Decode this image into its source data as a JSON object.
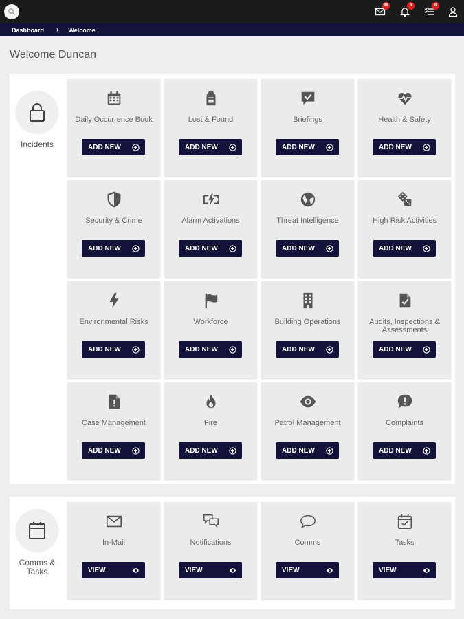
{
  "breadcrumb": {
    "items": [
      "Dashboard",
      "Welcome"
    ]
  },
  "header": {
    "badges": {
      "mail": "99",
      "notifications": "8",
      "tasks": "8"
    }
  },
  "welcome": "Welcome Duncan",
  "incidents": {
    "label": "Incidents",
    "button_label": "ADD NEW",
    "tiles": [
      {
        "label": "Daily Occurrence Book",
        "icon": "calendar-icon"
      },
      {
        "label": "Lost & Found",
        "icon": "backpack-icon"
      },
      {
        "label": "Briefings",
        "icon": "chat-check-icon"
      },
      {
        "label": "Health & Safety",
        "icon": "heart-pulse-icon"
      },
      {
        "label": "Security & Crime",
        "icon": "shield-icon"
      },
      {
        "label": "Alarm Activations",
        "icon": "bolt-battery-icon"
      },
      {
        "label": "Threat Intelligence",
        "icon": "globe-icon"
      },
      {
        "label": "High Risk Activities",
        "icon": "dice-icon"
      },
      {
        "label": "Environmental Risks",
        "icon": "lightning-icon"
      },
      {
        "label": "Workforce",
        "icon": "flag-icon"
      },
      {
        "label": "Building Operations",
        "icon": "building-icon"
      },
      {
        "label": "Audits, Inspections & Assessments",
        "icon": "file-check-icon"
      },
      {
        "label": "Case Management",
        "icon": "file-alert-icon"
      },
      {
        "label": "Fire",
        "icon": "fire-icon"
      },
      {
        "label": "Patrol Management",
        "icon": "eye-icon"
      },
      {
        "label": "Complaints",
        "icon": "alert-bubble-icon"
      }
    ]
  },
  "comms": {
    "label": "Comms & Tasks",
    "button_label": "VIEW",
    "tiles": [
      {
        "label": "In-Mail",
        "icon": "envelope-icon"
      },
      {
        "label": "Notifications",
        "icon": "chat-bubbles-icon"
      },
      {
        "label": "Comms",
        "icon": "speech-bubble-icon"
      },
      {
        "label": "Tasks",
        "icon": "calendar-check-icon"
      }
    ]
  }
}
